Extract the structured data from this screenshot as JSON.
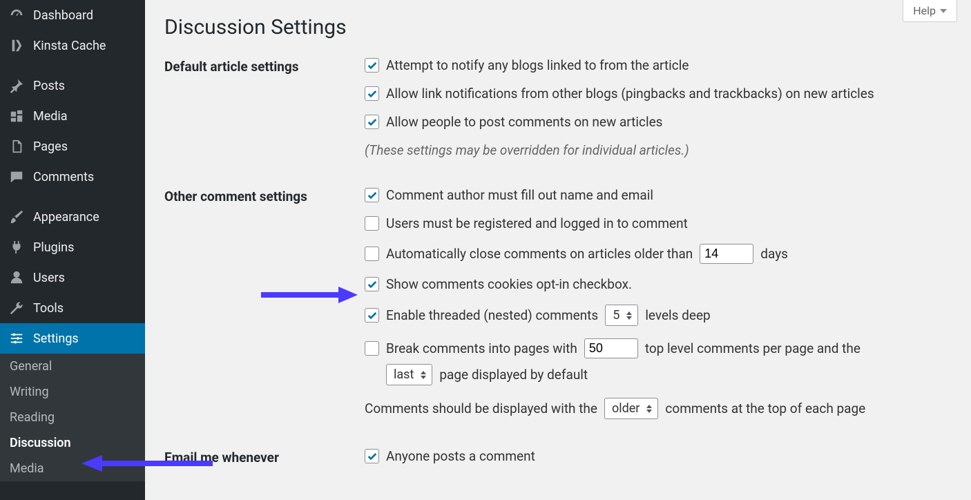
{
  "header": {
    "help_label": "Help",
    "page_title": "Discussion Settings"
  },
  "sidebar": {
    "items": [
      {
        "label": "Dashboard",
        "icon": "dashboard"
      },
      {
        "label": "Kinsta Cache",
        "icon": "kinsta"
      },
      {
        "label": "Posts",
        "icon": "pin"
      },
      {
        "label": "Media",
        "icon": "media"
      },
      {
        "label": "Pages",
        "icon": "pages"
      },
      {
        "label": "Comments",
        "icon": "comment"
      },
      {
        "label": "Appearance",
        "icon": "brush"
      },
      {
        "label": "Plugins",
        "icon": "plug"
      },
      {
        "label": "Users",
        "icon": "users"
      },
      {
        "label": "Tools",
        "icon": "wrench"
      },
      {
        "label": "Settings",
        "icon": "sliders",
        "active": true
      }
    ],
    "subitems": [
      {
        "label": "General"
      },
      {
        "label": "Writing"
      },
      {
        "label": "Reading"
      },
      {
        "label": "Discussion",
        "current": true
      },
      {
        "label": "Media"
      }
    ]
  },
  "sections": {
    "default_article": {
      "heading": "Default article settings",
      "notify_linked_blogs": {
        "checked": true,
        "label": "Attempt to notify any blogs linked to from the article"
      },
      "allow_pingbacks": {
        "checked": true,
        "label": "Allow link notifications from other blogs (pingbacks and trackbacks) on new articles"
      },
      "allow_comments": {
        "checked": true,
        "label": "Allow people to post comments on new articles"
      },
      "override_note": "(These settings may be overridden for individual articles.)"
    },
    "other_comment": {
      "heading": "Other comment settings",
      "require_name_email": {
        "checked": true,
        "label": "Comment author must fill out name and email"
      },
      "require_registered": {
        "checked": false,
        "label": "Users must be registered and logged in to comment"
      },
      "auto_close": {
        "checked": false,
        "prefix": "Automatically close comments on articles older than",
        "days_value": "14",
        "suffix": "days"
      },
      "cookies_optin": {
        "checked": true,
        "label": "Show comments cookies opt-in checkbox."
      },
      "threaded": {
        "checked": true,
        "prefix": "Enable threaded (nested) comments",
        "levels_value": "5",
        "suffix": "levels deep"
      },
      "paginate": {
        "checked": false,
        "prefix": "Break comments into pages with",
        "per_page_value": "50",
        "mid": "top level comments per page and the",
        "page_select_value": "last",
        "suffix": "page displayed by default"
      },
      "order": {
        "prefix": "Comments should be displayed with the",
        "order_select_value": "older",
        "suffix": "comments at the top of each page"
      }
    },
    "email_whenever": {
      "heading": "Email me whenever",
      "anyone_posts": {
        "checked": true,
        "label": "Anyone posts a comment"
      }
    }
  }
}
